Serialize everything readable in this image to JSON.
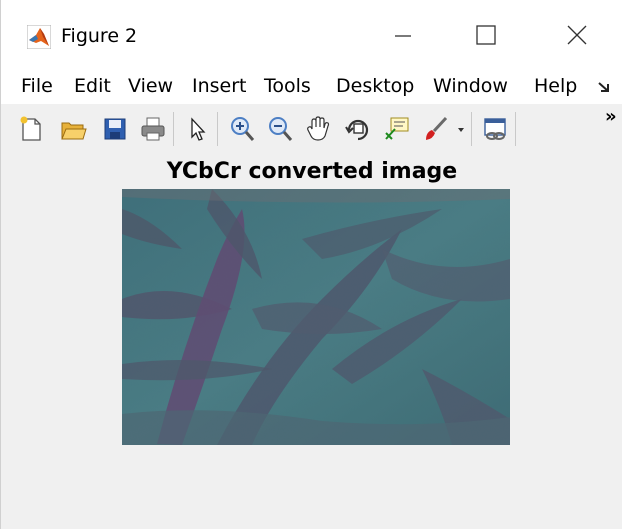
{
  "window": {
    "title": "Figure 2"
  },
  "menu": {
    "items": [
      "File",
      "Edit",
      "View",
      "Insert",
      "Tools",
      "Desktop",
      "Window",
      "Help"
    ]
  },
  "toolbar": {
    "tools": [
      "new-figure-icon",
      "open-file-icon",
      "save-icon",
      "print-icon",
      "edit-plot-arrow-icon",
      "zoom-in-icon",
      "zoom-out-icon",
      "pan-hand-icon",
      "rotate-3d-icon",
      "data-cursor-icon",
      "brush-icon",
      "link-plot-icon"
    ],
    "overflow_label": "»"
  },
  "figure": {
    "axes_title": "YCbCr converted image"
  },
  "colors": {
    "figure_bg": "#f0f0f0",
    "image_base": "#3f6f78",
    "image_leaf": "#5a4a6e"
  }
}
